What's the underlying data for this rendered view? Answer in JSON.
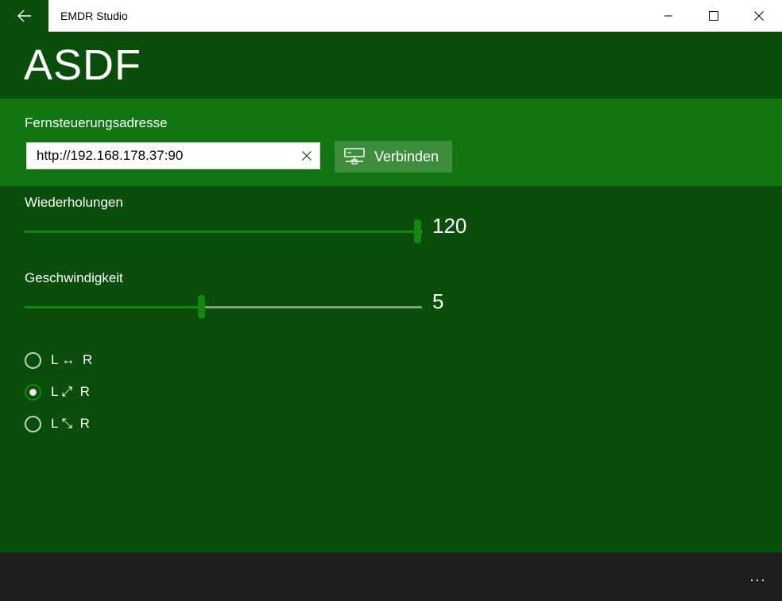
{
  "titlebar": {
    "app_title": "EMDR Studio",
    "back_icon": "arrow-left-icon",
    "controls": [
      "minimize-icon",
      "maximize-icon",
      "close-icon"
    ]
  },
  "page": {
    "title": "ASDF"
  },
  "connection": {
    "label": "Fernsteuerungsadresse",
    "address_value": "http://192.168.178.37:90",
    "clear_icon": "clear-x-icon",
    "connect_label": "Verbinden",
    "connect_icon": "network-icon"
  },
  "sliders": {
    "repetitions": {
      "label": "Wiederholungen",
      "value": "120",
      "fraction": 0.99
    },
    "speed": {
      "label": "Geschwindigkeit",
      "value": "5",
      "fraction": 0.445
    }
  },
  "direction_options": [
    {
      "label": "L ↔  R",
      "checked": false
    },
    {
      "label": "L ⤢  R",
      "checked": true
    },
    {
      "label": "L ⤡  R",
      "checked": false
    }
  ],
  "appbar": {
    "more_label": "..."
  },
  "colors": {
    "dark_green": "#0b4d0b",
    "panel_green": "#117511",
    "accent": "#118811",
    "button_green": "#3d8d3d",
    "appbar": "#1f1f1f"
  }
}
